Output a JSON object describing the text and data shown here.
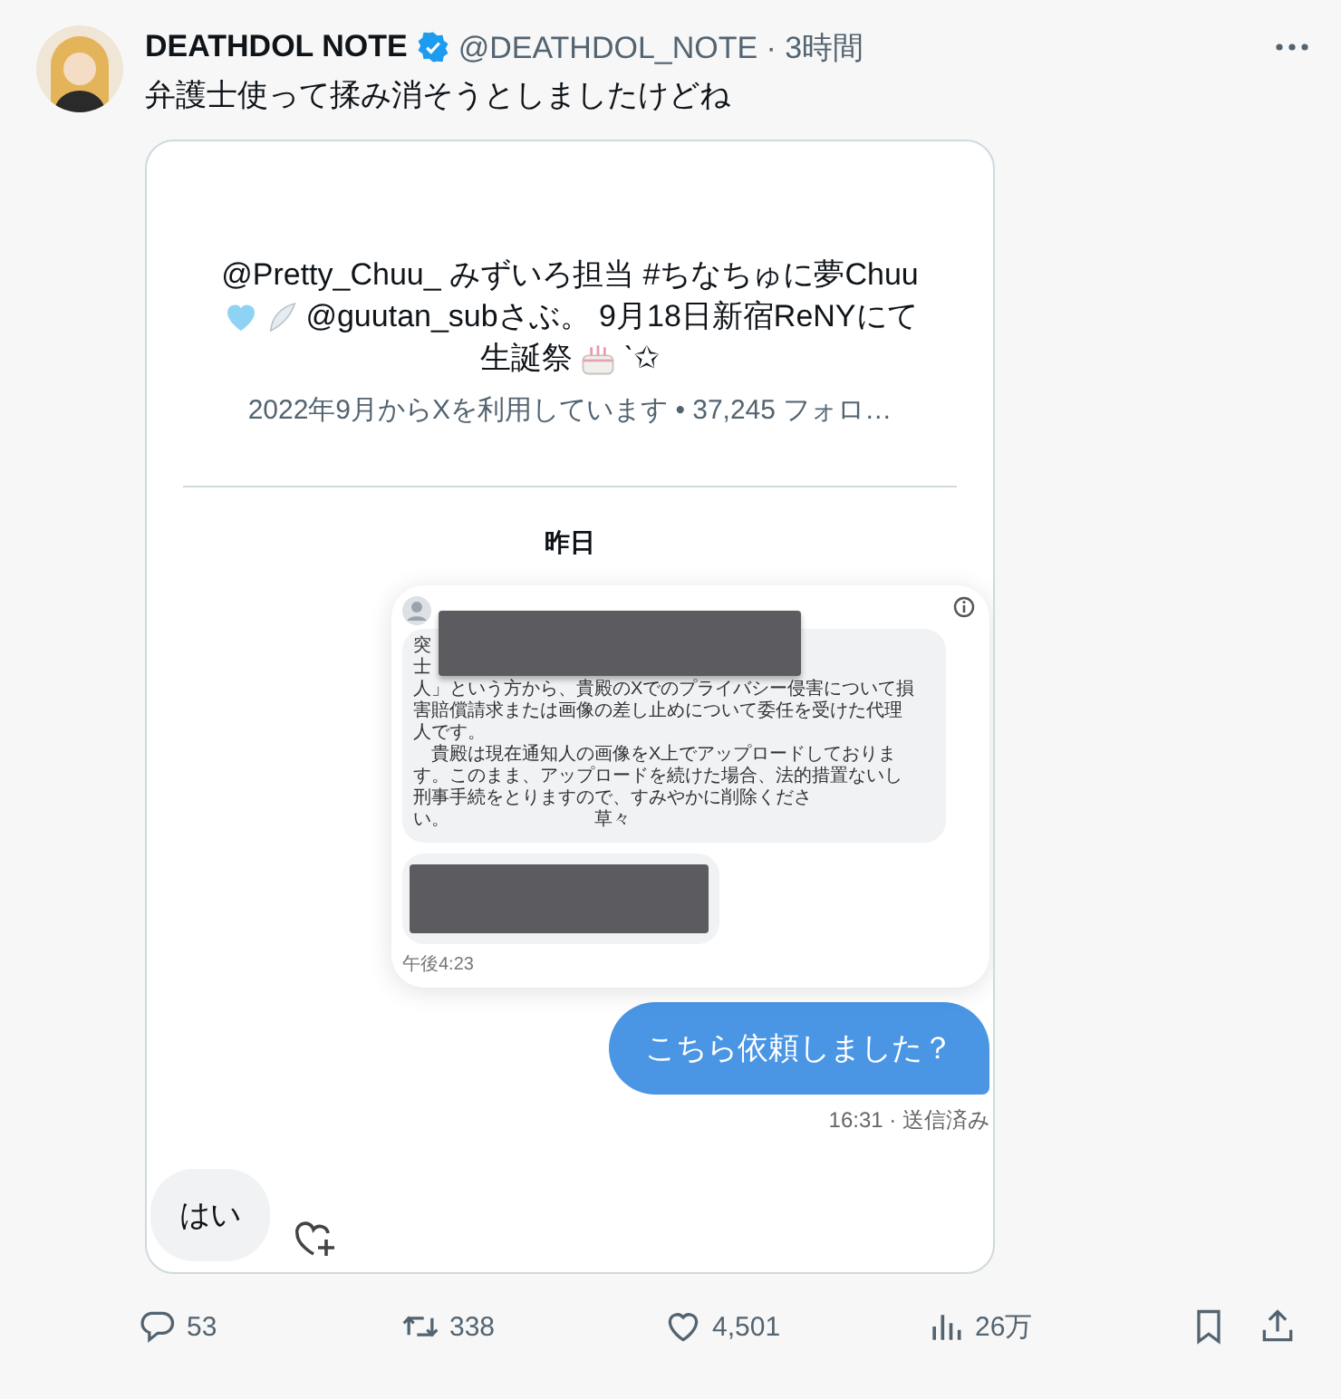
{
  "post": {
    "display_name": "DEATHDOL NOTE",
    "verified": true,
    "meta": "@DEATHDOL_NOTE · 3時間",
    "text": "弁護士使って揉み消そうとしましたけどね"
  },
  "embedded_screenshot": {
    "bio_lines": [
      [
        {
          "kind": "text",
          "text": "@Pretty_Chuu_ みずいろ担当 #ちなちゅに夢Chuu"
        }
      ],
      [
        {
          "kind": "heart"
        },
        {
          "kind": "wing"
        },
        {
          "kind": "text",
          "text": "@guutan_subさぶ。 9月18日新宿ReNYにて"
        }
      ],
      [
        {
          "kind": "text",
          "text": "生誕祭"
        },
        {
          "kind": "cake"
        },
        {
          "kind": "text",
          "text": "ˋ✩"
        }
      ]
    ],
    "joined_info": "2022年9月からXを利用しています • 37,245 フォロ…",
    "date_divider": "昨日",
    "messages": [
      {
        "kind": "image",
        "letter_lines": [
          "突",
          "士",
          "人」という方から、貴殿のXでのプライバシー侵害について損",
          "害賠償請求または画像の差し止めについて委任を受けた代理",
          "人です。",
          "　貴殿は現在通知人の画像をX上でアップロードしておりま",
          "す。このまま、アップロードを続けた場合、法的措置ないし",
          "刑事手続をとりますので、すみやかに削除くださ",
          "い。　　　　　　　　草々"
        ],
        "timestamp": "午後4:23"
      },
      {
        "kind": "sent",
        "text": "こちら依頼しました？",
        "status": "16:31 · 送信済み"
      },
      {
        "kind": "received",
        "text": "はい"
      }
    ]
  },
  "actions": [
    {
      "kind": "reply",
      "count": "53"
    },
    {
      "kind": "repost",
      "count": "338"
    },
    {
      "kind": "like",
      "count": "4,501"
    },
    {
      "kind": "views",
      "count": "26万"
    },
    {
      "kind": "bookmark"
    },
    {
      "kind": "share"
    }
  ]
}
